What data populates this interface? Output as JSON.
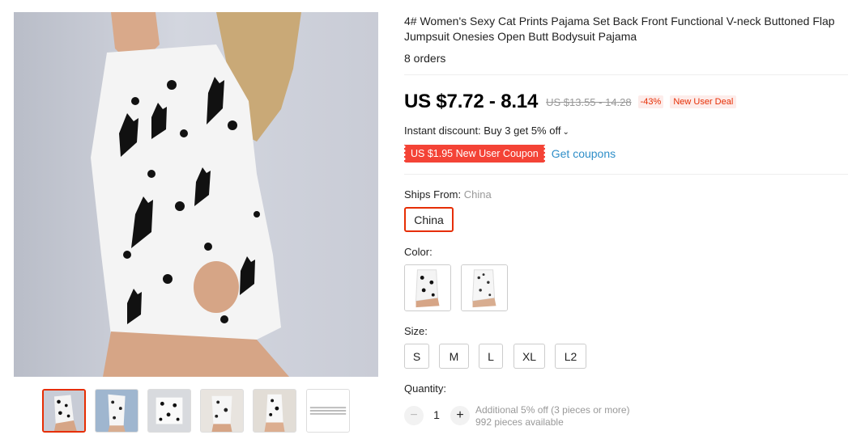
{
  "gallery": {
    "thumbnails": [
      {
        "name": "thumb-1",
        "active": true
      },
      {
        "name": "thumb-2",
        "active": false
      },
      {
        "name": "thumb-3",
        "active": false
      },
      {
        "name": "thumb-4",
        "active": false
      },
      {
        "name": "thumb-5",
        "active": false
      },
      {
        "name": "thumb-6",
        "active": false
      }
    ]
  },
  "product": {
    "title": "4# Women's Sexy Cat Prints Pajama Set Back Front Functional V-neck Buttoned Flap Jumpsuit Onesies Open Butt Bodysuit Pajama",
    "orders": "8 orders"
  },
  "pricing": {
    "price": "US $7.72 - 8.14",
    "original_price": "US $13.55 - 14.28",
    "discount": "-43%",
    "deal_tag": "New User Deal",
    "instant_discount": "Instant discount: Buy 3 get 5% off",
    "coupon": "US $1.95 New User Coupon",
    "get_coupons": "Get coupons"
  },
  "shipping": {
    "label": "Ships From:",
    "selected": "China",
    "option": "China"
  },
  "color": {
    "label": "Color:"
  },
  "size": {
    "label": "Size:",
    "options": [
      "S",
      "M",
      "L",
      "XL",
      "L2"
    ]
  },
  "quantity": {
    "label": "Quantity:",
    "minus": "−",
    "plus": "+",
    "value": "1",
    "note_line1": "Additional 5% off (3 pieces or more)",
    "note_line2": "992 pieces available"
  },
  "colors": {
    "accent": "#e62e04",
    "coupon_bg": "#f44336",
    "link": "#2e8ec8"
  }
}
